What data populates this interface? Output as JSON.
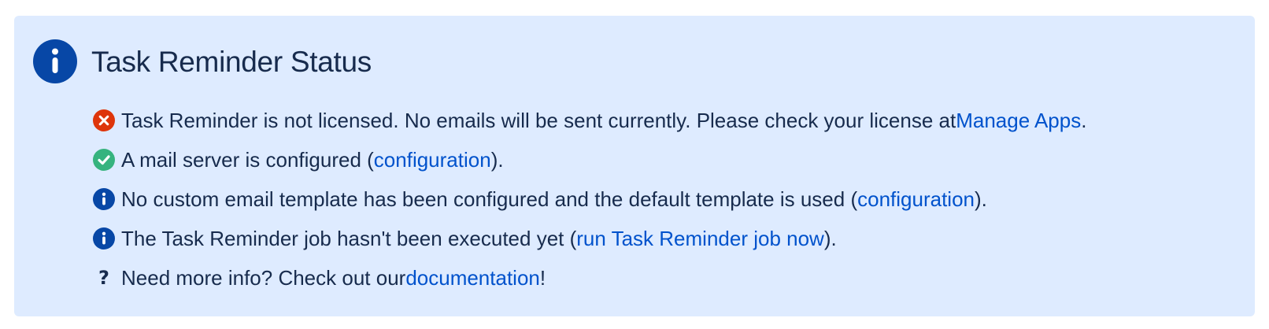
{
  "status_panel": {
    "title": "Task Reminder Status",
    "title_icon": "info-icon",
    "colors": {
      "panel_background": "#deebff",
      "text": "#172b4d",
      "link": "#0052cc",
      "info": "#0747a6",
      "error": "#de350b",
      "success": "#36b37e"
    },
    "items": [
      {
        "icon": "error-icon",
        "before": "Task Reminder is not licensed. No emails will be sent currently. Please check your license at ",
        "link": "Manage Apps",
        "after": "."
      },
      {
        "icon": "check-icon",
        "before": "A mail server is configured (",
        "link": "configuration",
        "after": ")."
      },
      {
        "icon": "info-icon",
        "before": "No custom email template has been configured and the default template is used (",
        "link": "configuration",
        "after": ")."
      },
      {
        "icon": "info-icon",
        "before": "The Task Reminder job hasn't been executed yet (",
        "link": "run Task Reminder job now",
        "after": ")."
      },
      {
        "icon": "question-icon",
        "glyph": "?",
        "before": "Need more info? Check out our ",
        "link": "documentation",
        "after": "!"
      }
    ]
  }
}
